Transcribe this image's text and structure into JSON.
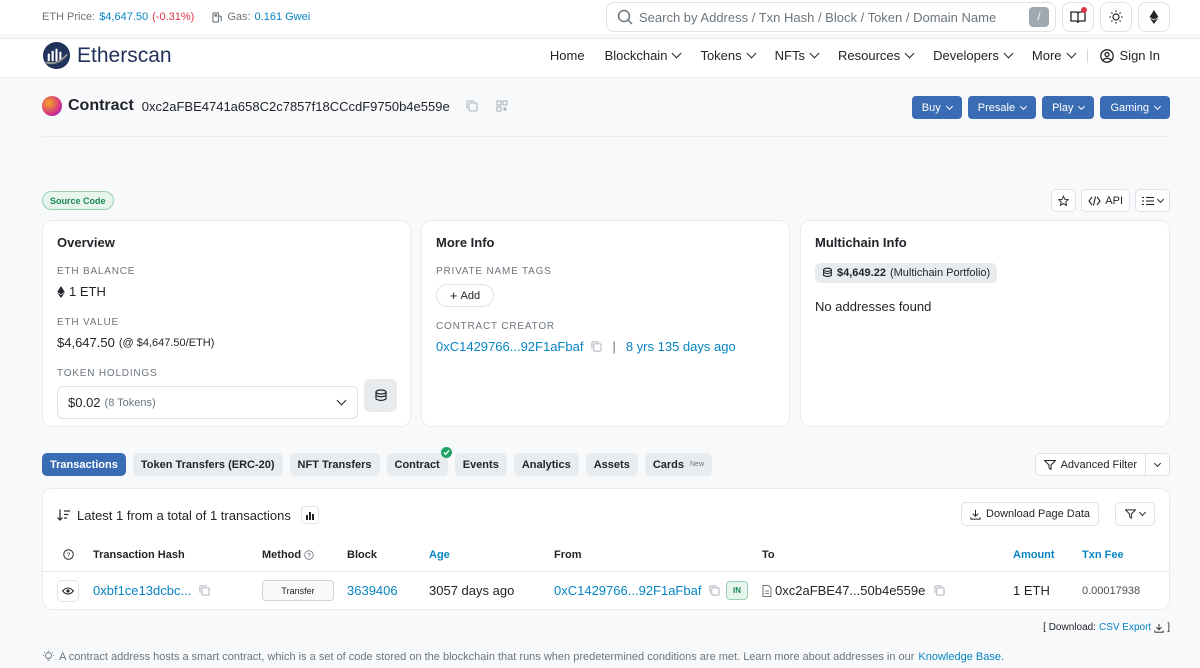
{
  "topbar": {
    "eth_price_label": "ETH Price:",
    "eth_price_value": "$4,647.50",
    "eth_price_change": "(-0.31%)",
    "gas_label": "Gas:",
    "gas_value": "0.161 Gwei",
    "search_placeholder": "Search by Address / Txn Hash / Block / Token / Domain Name",
    "search_shortcut": "/"
  },
  "navbar": {
    "brand": "Etherscan",
    "items": [
      "Home",
      "Blockchain",
      "Tokens",
      "NFTs",
      "Resources",
      "Developers",
      "More"
    ],
    "sign_in": "Sign In"
  },
  "contract": {
    "label": "Contract",
    "address": "0xc2aFBE4741a658C2c7857f18CCcdF9750b4e559e",
    "buttons": [
      "Buy",
      "Presale",
      "Play",
      "Gaming"
    ],
    "source_badge": "Source Code",
    "api_label": "API"
  },
  "overview": {
    "title": "Overview",
    "eth_balance_label": "ETH BALANCE",
    "eth_balance": "1 ETH",
    "eth_value_label": "ETH VALUE",
    "eth_value": "$4,647.50",
    "eth_value_rate": "(@ $4,647.50/ETH)",
    "token_holdings_label": "TOKEN HOLDINGS",
    "token_value": "$0.02",
    "token_count": "(8 Tokens)"
  },
  "more_info": {
    "title": "More Info",
    "private_tags_label": "PRIVATE NAME TAGS",
    "add_label": "Add",
    "creator_label": "CONTRACT CREATOR",
    "creator_address": "0xC1429766...92F1aFbaf",
    "creator_age": "8 yrs 135 days ago"
  },
  "multichain": {
    "title": "Multichain Info",
    "portfolio_value": "$4,649.22",
    "portfolio_label": "(Multichain Portfolio)",
    "empty": "No addresses found"
  },
  "tabs": [
    {
      "label": "Transactions",
      "active": true
    },
    {
      "label": "Token Transfers (ERC-20)"
    },
    {
      "label": "NFT Transfers"
    },
    {
      "label": "Contract",
      "verified": true
    },
    {
      "label": "Events"
    },
    {
      "label": "Analytics"
    },
    {
      "label": "Assets"
    },
    {
      "label": "Cards",
      "badge": "New"
    }
  ],
  "advanced_filter": "Advanced Filter",
  "transactions": {
    "summary": "Latest 1 from a total of 1 transactions",
    "download_label": "Download Page Data",
    "columns": [
      "Transaction Hash",
      "Method",
      "Block",
      "Age",
      "From",
      "To",
      "Amount",
      "Txn Fee"
    ],
    "rows": [
      {
        "hash": "0xbf1ce13dcbc...",
        "method": "Transfer",
        "block": "3639406",
        "age": "3057 days ago",
        "from": "0xC1429766...92F1aFbaf",
        "direction": "IN",
        "to": "0xc2aFBE47...50b4e559e",
        "amount": "1 ETH",
        "fee": "0.00017938"
      }
    ]
  },
  "csv": {
    "prefix": "[ Download:",
    "link": "CSV Export",
    "suffix": "]"
  },
  "footer_note": {
    "text": "A contract address hosts a smart contract, which is a set of code stored on the blockchain that runs when predetermined conditions are met. Learn more about addresses in our",
    "link": "Knowledge Base."
  },
  "colors": {
    "primary": "#3a6cb3",
    "link": "#0784c3",
    "negative": "#dc3545",
    "success": "#198754"
  }
}
